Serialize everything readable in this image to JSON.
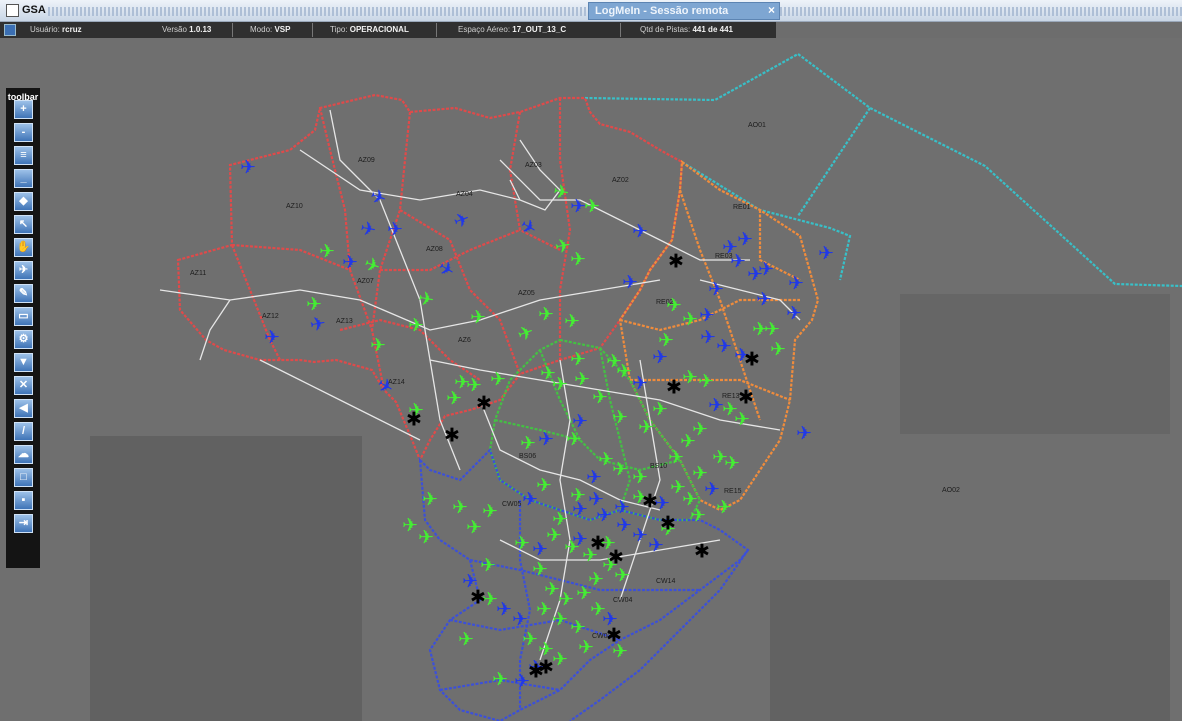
{
  "window": {
    "app_name": "GSA",
    "session_title": "LogMeIn - Sessão remota",
    "close_glyph": "×"
  },
  "status": {
    "user_label": "Usuário:",
    "user_value": "rcruz",
    "version_label": "Versão",
    "version_value": "1.0.13",
    "mode_label": "Modo:",
    "mode_value": "VSP",
    "type_label": "Tipo:",
    "type_value": "OPERACIONAL",
    "airspace_label": "Espaço Aéreo:",
    "airspace_value": "17_OUT_13_C",
    "tracks_label": "Qtd de Pistas:",
    "tracks_value": "441 de 441"
  },
  "toolbar": {
    "title": "toolbar",
    "tools": [
      {
        "icon": "zoom-in-icon",
        "glyph": "+"
      },
      {
        "icon": "zoom-out-icon",
        "glyph": "-"
      },
      {
        "icon": "layers-icon",
        "glyph": "≡"
      },
      {
        "icon": "minimize-icon",
        "glyph": "_"
      },
      {
        "icon": "map-icon",
        "glyph": "◆"
      },
      {
        "icon": "pointer-icon",
        "glyph": "↖"
      },
      {
        "icon": "hand-icon",
        "glyph": "✋"
      },
      {
        "icon": "aircraft-tool-icon",
        "glyph": "✈"
      },
      {
        "icon": "pencil-icon",
        "glyph": "✎"
      },
      {
        "icon": "label-icon",
        "glyph": "▭"
      },
      {
        "icon": "settings-icon",
        "glyph": "⚙"
      },
      {
        "icon": "filter-icon",
        "glyph": "▼"
      },
      {
        "icon": "cross-icon",
        "glyph": "✕"
      },
      {
        "icon": "sound-icon",
        "glyph": "◀"
      },
      {
        "icon": "ruler-icon",
        "glyph": "/"
      },
      {
        "icon": "weather-icon",
        "glyph": "☁"
      },
      {
        "icon": "window-icon",
        "glyph": "□"
      },
      {
        "icon": "save-icon",
        "glyph": "▪"
      },
      {
        "icon": "exit-icon",
        "glyph": "⇥"
      }
    ]
  },
  "map": {
    "colors": {
      "background": "#6f6f6f",
      "amazonica": "#e04a4a",
      "recife": "#f08c3c",
      "brasilia": "#44c044",
      "curitiba": "#3c50d8",
      "atlantico": "#38c0c8",
      "roads": "#e6e6e6",
      "aircraft_green": "#44ee33",
      "aircraft_blue": "#2038e8",
      "aircraft_black": "#000000"
    },
    "sectors": [
      {
        "id": "AZ09"
      },
      {
        "id": "AZ10"
      },
      {
        "id": "AZ04"
      },
      {
        "id": "AZ03"
      },
      {
        "id": "AZ02"
      },
      {
        "id": "AZ11"
      },
      {
        "id": "AZ07"
      },
      {
        "id": "AZ08"
      },
      {
        "id": "AZ05"
      },
      {
        "id": "AZ12"
      },
      {
        "id": "AZ13"
      },
      {
        "id": "AZ6"
      },
      {
        "id": "AZ14"
      },
      {
        "id": "AO01"
      },
      {
        "id": "RE01"
      },
      {
        "id": "RE02"
      },
      {
        "id": "RE03"
      },
      {
        "id": "RE13"
      },
      {
        "id": "RE15"
      },
      {
        "id": "AO02"
      },
      {
        "id": "BS06"
      },
      {
        "id": "BS10"
      },
      {
        "id": "CW05"
      },
      {
        "id": "CW04"
      },
      {
        "id": "CW14"
      },
      {
        "id": "CW03"
      }
    ],
    "aircraft_glyph": "✈",
    "hold_glyph": "✱"
  }
}
